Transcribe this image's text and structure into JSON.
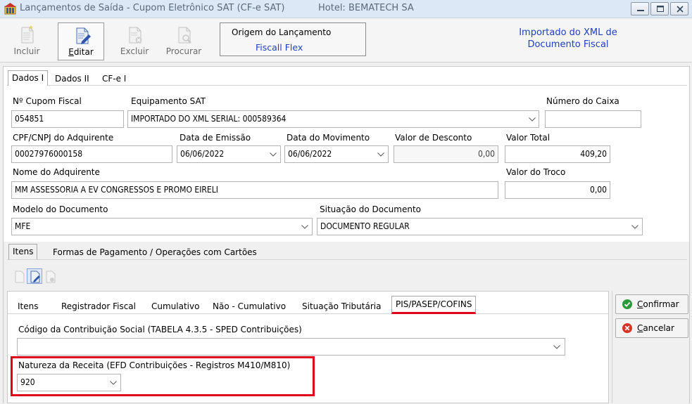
{
  "window": {
    "title": "Lançamentos de Saída - Cupom Eletrônico SAT (CF-e SAT)",
    "hotel": "Hotel: BEMATECH SA"
  },
  "toolbar": {
    "incluir": "Incluir",
    "editar": "Editar",
    "excluir": "Excluir",
    "procurar": "Procurar",
    "origem_title": "Origem do Lançamento",
    "origem_value": "Fiscall Flex",
    "import_note_line1": "Importado do XML de",
    "import_note_line2": "Documento Fiscal"
  },
  "tabs": [
    "Dados I",
    "Dados II",
    "CF-e I"
  ],
  "form": {
    "cupom_label": "Nº Cupom Fiscal",
    "cupom_value": "054851",
    "equip_label": "Equipamento SAT",
    "equip_value": "IMPORTADO DO XML SERIAL: 000589364",
    "caixa_label": "Número do Caixa",
    "caixa_value": "",
    "cpf_label": "CPF/CNPJ do Adquirente",
    "cpf_value": "00027976000158",
    "emissao_label": "Data de Emissão",
    "emissao_value": "06/06/2022",
    "movimento_label": "Data do Movimento",
    "movimento_value": "06/06/2022",
    "desconto_label": "Valor de Desconto",
    "desconto_value": "0,00",
    "total_label": "Valor Total",
    "total_value": "409,20",
    "nome_label": "Nome do Adquirente",
    "nome_value": "MM ASSESSORIA A EV CONGRESSOS E PROMO EIRELI",
    "troco_label": "Valor do Troco",
    "troco_value": "0,00",
    "modelo_label": "Modelo do Documento",
    "modelo_value": "MFE",
    "situacao_label": "Situação do Documento",
    "situacao_value": "DOCUMENTO REGULAR"
  },
  "lower_tabs": [
    "Itens",
    "Formas de Pagamento / Operações com Cartões"
  ],
  "item_tabs": [
    "Itens",
    "Registrador Fiscal",
    "Cumulativo",
    "Não - Cumulativo",
    "Situação Tributária",
    "PIS/PASEP/COFINS"
  ],
  "pis": {
    "codigo_label": "Código da Contribuição Social (TABELA 4.3.5 - SPED Contribuições)",
    "codigo_value": "",
    "natureza_label": "Natureza da Receita (EFD Contribuições - Registros M410/M810)",
    "natureza_value": "920"
  },
  "actions": {
    "confirmar": "Confirmar",
    "cancelar": "Cancelar"
  },
  "colors": {
    "accent_blue": "#1f3fc0",
    "highlight_red": "#e0001b",
    "confirm_green": "#2e9b3a",
    "cancel_red": "#d6332a"
  }
}
